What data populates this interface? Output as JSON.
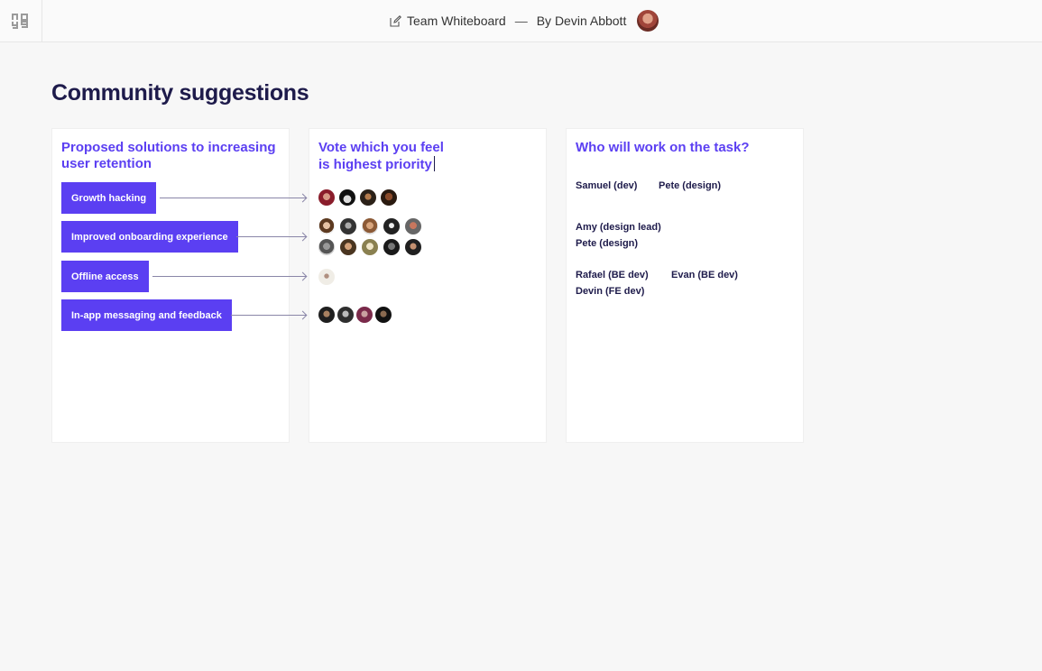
{
  "header": {
    "doc_title": "Team Whiteboard",
    "separator": "—",
    "author": "By Devin Abbott"
  },
  "page": {
    "title": "Community suggestions"
  },
  "cards": {
    "solutions": {
      "heading_line1": "Proposed solutions to increasing",
      "heading_line2": "user retention",
      "items": [
        {
          "label": "Growth hacking",
          "votes": 4
        },
        {
          "label": "Improved onboarding experience",
          "votes": 10
        },
        {
          "label": "Offline access",
          "votes": 1
        },
        {
          "label": "In-app messaging and feedback",
          "votes": 4
        }
      ]
    },
    "vote": {
      "heading_line1": "Vote which you feel",
      "heading_line2": "is highest priority"
    },
    "assignees": {
      "heading": "Who will work on the task?",
      "rows": [
        [
          "Samuel (dev)",
          "Pete (design)"
        ],
        [
          "Amy (design lead)",
          "Pete (design)"
        ],
        [
          "Rafael (BE dev)",
          "Evan (BE dev)",
          "Devin (FE dev)"
        ]
      ]
    }
  },
  "colors": {
    "accent": "#5b3ff2",
    "heading_dark": "#1e1b4b",
    "background": "#f7f7f7"
  },
  "icons": {
    "logo": "noya-logo",
    "title_edit": "edit-icon"
  }
}
